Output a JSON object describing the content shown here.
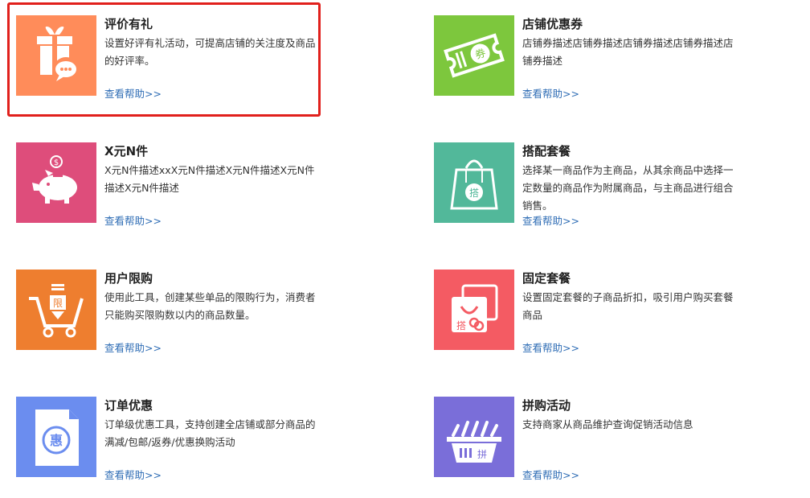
{
  "cards": [
    {
      "title": "评价有礼",
      "desc": "设置好评有礼活动，可提高店铺的关注度及商品的好评率。",
      "help": "查看帮助>>",
      "color": "#ff8c5a",
      "icon": "gift-icon"
    },
    {
      "title": "店铺优惠券",
      "desc": "店铺券描述店铺券描述店铺券描述店铺券描述店铺券描述",
      "help": "查看帮助>>",
      "color": "#7dc73d",
      "icon": "coupon-icon",
      "icon_text": "券"
    },
    {
      "title": "X元N件",
      "desc": "X元N件描述xxX元N件描述X元N件描述X元N件描述X元N件描述",
      "help": "查看帮助>>",
      "color": "#de4d7b",
      "icon": "piggy-bank-icon"
    },
    {
      "title": "搭配套餐",
      "desc": "选择某一商品作为主商品，从其余商品中选择一定数量的商品作为附属商品，与主商品进行组合销售。",
      "help": "查看帮助>>",
      "color": "#52b89a",
      "icon": "shopping-bag-icon",
      "icon_text": "搭"
    },
    {
      "title": "用户限购",
      "desc": "使用此工具，创建某些单品的限购行为，消费者只能购买限购数以内的商品数量。",
      "help": "查看帮助>>",
      "color": "#ee7e2f",
      "icon": "cart-limit-icon",
      "icon_text": "限"
    },
    {
      "title": "固定套餐",
      "desc": "设置固定套餐的子商品折扣，吸引用户购买套餐商品",
      "help": "查看帮助>>",
      "color": "#f45b63",
      "icon": "bundle-icon",
      "icon_text": "搭"
    },
    {
      "title": "订单优惠",
      "desc": "订单级优惠工具，支持创建全店铺或部分商品的满减/包邮/返券/优惠换购活动",
      "help": "查看帮助>>",
      "color": "#6b8def",
      "icon": "order-discount-icon",
      "icon_text": "惠"
    },
    {
      "title": "拼购活动",
      "desc": "支持商家从商品维护查询促销活动信息",
      "help": "查看帮助>>",
      "color": "#7a6ed9",
      "icon": "basket-icon",
      "icon_text": "拼"
    }
  ]
}
